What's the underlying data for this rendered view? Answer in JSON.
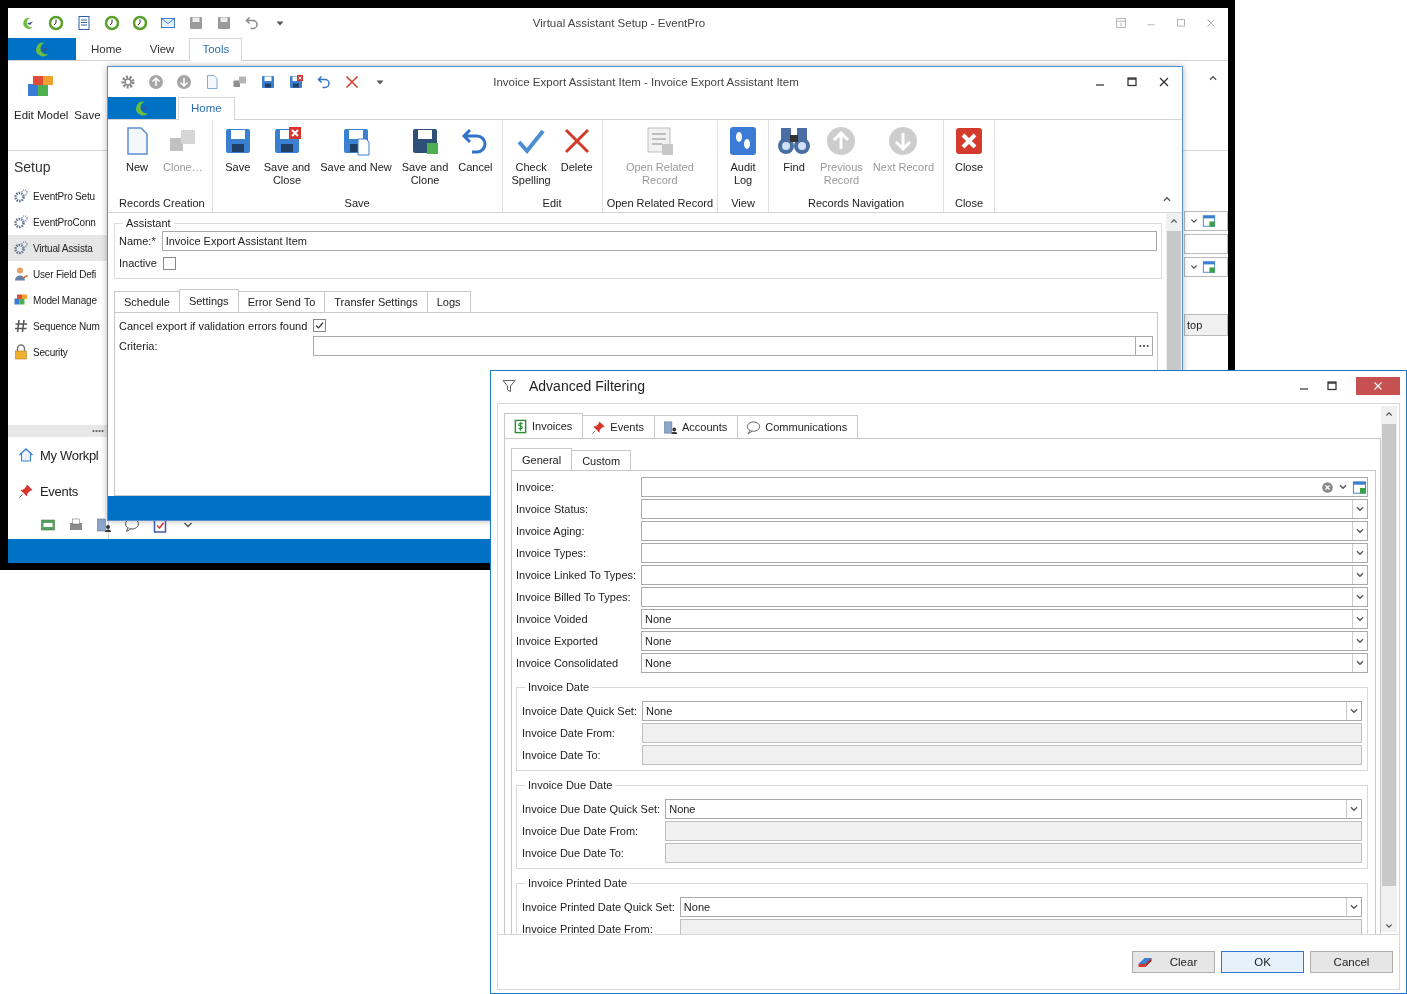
{
  "background_window": {
    "title": "Virtual Assistant Setup - EventPro",
    "tabs": [
      {
        "label": "Home",
        "selected": false
      },
      {
        "label": "View",
        "selected": false
      },
      {
        "label": "Tools",
        "selected": true
      }
    ],
    "ribbon_buttons": [
      "Edit Model",
      "Save"
    ],
    "sidebar": {
      "heading": "Setup",
      "items": [
        {
          "label": "EventPro Setu",
          "selected": false
        },
        {
          "label": "EventProConn",
          "selected": false
        },
        {
          "label": "Virtual Assista",
          "selected": true
        },
        {
          "label": "User Field Defi",
          "selected": false
        },
        {
          "label": "Model Manage",
          "selected": false
        },
        {
          "label": "Sequence Num",
          "selected": false
        },
        {
          "label": "Security",
          "selected": false
        }
      ]
    },
    "nav_items": [
      "My Workpl",
      "Events"
    ],
    "side_button": "top"
  },
  "record_window": {
    "title": "Invoice Export Assistant Item - Invoice Export Assistant Item",
    "tabs": [
      {
        "label": "Home",
        "selected": true
      }
    ],
    "ribbon_groups": [
      {
        "caption": "Records Creation",
        "buttons": [
          {
            "label": "New",
            "disabled": false
          },
          {
            "label": "Clone…",
            "disabled": true
          }
        ]
      },
      {
        "caption": "Save",
        "buttons": [
          {
            "label": "Save",
            "disabled": false
          },
          {
            "label": "Save and\nClose",
            "disabled": false
          },
          {
            "label": "Save and New",
            "disabled": false
          },
          {
            "label": "Save and\nClone",
            "disabled": false
          },
          {
            "label": "Cancel",
            "disabled": false
          }
        ]
      },
      {
        "caption": "Edit",
        "buttons": [
          {
            "label": "Check\nSpelling",
            "disabled": false
          },
          {
            "label": "Delete",
            "disabled": false
          }
        ]
      },
      {
        "caption": "Open Related Record",
        "buttons": [
          {
            "label": "Open Related\nRecord",
            "disabled": true
          }
        ]
      },
      {
        "caption": "View",
        "buttons": [
          {
            "label": "Audit\nLog",
            "disabled": false
          }
        ]
      },
      {
        "caption": "Records Navigation",
        "buttons": [
          {
            "label": "Find",
            "disabled": false
          },
          {
            "label": "Previous\nRecord",
            "disabled": true
          },
          {
            "label": "Next Record",
            "disabled": true
          }
        ]
      },
      {
        "caption": "Close",
        "buttons": [
          {
            "label": "Close",
            "disabled": false
          }
        ]
      }
    ],
    "form": {
      "group": "Assistant",
      "name_label": "Name:*",
      "name_value": "Invoice Export Assistant Item",
      "inactive_label": "Inactive",
      "inactive_checked": false,
      "tabs": [
        {
          "label": "Schedule",
          "selected": false
        },
        {
          "label": "Settings",
          "selected": true
        },
        {
          "label": "Error Send To",
          "selected": false
        },
        {
          "label": "Transfer Settings",
          "selected": false
        },
        {
          "label": "Logs",
          "selected": false
        }
      ],
      "cancel_export_label": "Cancel export if validation errors found",
      "cancel_export_checked": true,
      "criteria_label": "Criteria:"
    }
  },
  "filter_dialog": {
    "title": "Advanced Filtering",
    "tabs": [
      {
        "label": "Invoices",
        "selected": true
      },
      {
        "label": "Events",
        "selected": false
      },
      {
        "label": "Accounts",
        "selected": false
      },
      {
        "label": "Communications",
        "selected": false
      }
    ],
    "subtabs": [
      {
        "label": "General",
        "selected": true
      },
      {
        "label": "Custom",
        "selected": false
      }
    ],
    "fields": [
      {
        "label": "Invoice:",
        "kind": "lookup"
      },
      {
        "label": "Invoice Status:",
        "kind": "combo"
      },
      {
        "label": "Invoice Aging:",
        "kind": "combo"
      },
      {
        "label": "Invoice Types:",
        "kind": "combo"
      },
      {
        "label": "Invoice Linked To Types:",
        "kind": "combo"
      },
      {
        "label": "Invoice Billed To Types:",
        "kind": "combo"
      },
      {
        "label": "Invoice Voided",
        "kind": "combo",
        "value": "None"
      },
      {
        "label": "Invoice Exported",
        "kind": "combo",
        "value": "None"
      },
      {
        "label": "Invoice Consolidated",
        "kind": "combo",
        "value": "None"
      }
    ],
    "groups": [
      {
        "title": "Invoice Date",
        "fields": [
          {
            "label": "Invoice Date Quick Set:",
            "kind": "combo",
            "value": "None"
          },
          {
            "label": "Invoice Date From:",
            "kind": "date"
          },
          {
            "label": "Invoice Date To:",
            "kind": "date"
          }
        ]
      },
      {
        "title": "Invoice Due Date",
        "fields": [
          {
            "label": "Invoice Due Date Quick Set:",
            "kind": "combo",
            "value": "None"
          },
          {
            "label": "Invoice Due Date From:",
            "kind": "date"
          },
          {
            "label": "Invoice Due Date To:",
            "kind": "date"
          }
        ]
      },
      {
        "title": "Invoice Printed Date",
        "fields": [
          {
            "label": "Invoice Printed Date Quick Set:",
            "kind": "combo",
            "value": "None"
          },
          {
            "label": "Invoice Printed Date From:",
            "kind": "date"
          }
        ]
      }
    ],
    "buttons": [
      {
        "label": "Clear",
        "kind": "clear"
      },
      {
        "label": "OK",
        "kind": "default"
      },
      {
        "label": "Cancel",
        "kind": "plain"
      }
    ]
  }
}
